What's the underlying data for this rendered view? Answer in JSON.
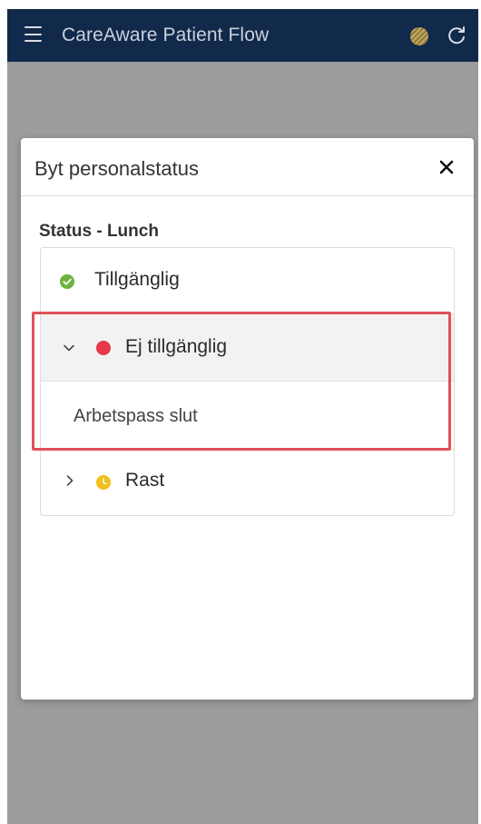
{
  "app": {
    "title": "CareAware Patient Flow",
    "menu_icon": "hamburger-menu-icon",
    "globe_icon": "globe-icon",
    "refresh_icon": "refresh-icon",
    "header_color": "#11294a"
  },
  "dialog": {
    "title": "Byt personalstatus",
    "close_icon": "close-icon",
    "section_label": "Status - Lunch",
    "statuses": [
      {
        "label": "Tillgänglig",
        "icon": "check-circle-icon",
        "color": "#6cb33f",
        "expanded": false
      },
      {
        "label": "Ej tillgänglig",
        "icon": "red-dot-icon",
        "color": "#e8374a",
        "expanded": true,
        "children": [
          {
            "label": "Arbetspass slut"
          }
        ]
      },
      {
        "label": "Rast",
        "icon": "clock-icon",
        "color": "#f2bf1d",
        "expanded": false
      }
    ]
  },
  "highlight_color": "#e0515a"
}
